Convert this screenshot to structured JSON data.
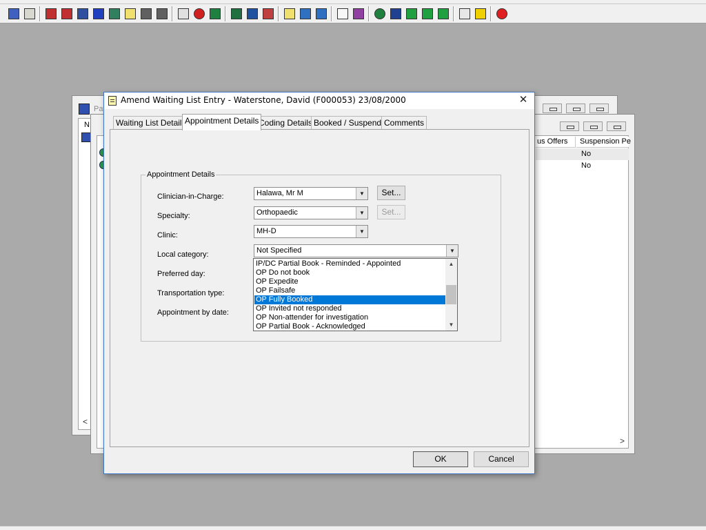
{
  "colors": {
    "desktop": "#aaaaaa",
    "selection": "#0078d7",
    "dialog_border": "#3e76c6"
  },
  "toolbar": {
    "icons": [
      {
        "name": "patient-icon",
        "color": "#4060c0"
      },
      {
        "name": "print-icon",
        "color": "#d8d8d0"
      },
      {
        "name": "book-icon",
        "color": "#c03030"
      },
      {
        "name": "notes-icon",
        "color": "#c03030"
      },
      {
        "name": "form-icon",
        "color": "#3050a0"
      },
      {
        "name": "mail-icon",
        "color": "#2040c0"
      },
      {
        "name": "doctor-icon",
        "color": "#308060"
      },
      {
        "name": "edit-icon",
        "color": "#f0e070"
      },
      {
        "name": "truck-icon",
        "color": "#606060"
      },
      {
        "name": "ambulance-icon",
        "color": "#606060"
      },
      {
        "name": "search-icon",
        "color": "#e0e0e0"
      },
      {
        "name": "clock-icon",
        "color": "#d02020"
      },
      {
        "name": "monitor-icon",
        "color": "#208040"
      },
      {
        "name": "screen-icon",
        "color": "#207040"
      },
      {
        "name": "screen-edit-icon",
        "color": "#2050a0"
      },
      {
        "name": "screen-clock-icon",
        "color": "#c04040"
      },
      {
        "name": "notepad-icon",
        "color": "#f0e070"
      },
      {
        "name": "bed-icon",
        "color": "#3070c0"
      },
      {
        "name": "bed-transfer-icon",
        "color": "#3070c0"
      },
      {
        "name": "document-icon",
        "color": "#f8f8f8"
      },
      {
        "name": "report-chart-icon",
        "color": "#9040a0"
      },
      {
        "name": "globe-icon",
        "color": "#208040"
      },
      {
        "name": "list-check-icon",
        "color": "#204090"
      },
      {
        "name": "list-down-icon",
        "color": "#20a040"
      },
      {
        "name": "list-arrow-icon",
        "color": "#20a040"
      },
      {
        "name": "list-swap-icon",
        "color": "#20a040"
      },
      {
        "name": "transfer-icon",
        "color": "#e8e8e8"
      },
      {
        "name": "warning-icon",
        "color": "#f0d000"
      },
      {
        "name": "exit-icon",
        "color": "#e02020"
      }
    ]
  },
  "background_windows": {
    "back_title_fragment": "Pat",
    "back_column_fragment": "N",
    "middle_column_headers": [
      "us Offers",
      "Suspension Pe"
    ],
    "middle_rows": [
      {
        "suspension": "No"
      },
      {
        "suspension": "No"
      }
    ],
    "scroll_left_glyph": "<",
    "scroll_right_glyph": ">"
  },
  "dialog": {
    "title": "Amend Waiting List Entry - Waterstone, David (F000053) 23/08/2000",
    "close_glyph": "✕",
    "tabs": [
      {
        "label": "Waiting List Details",
        "active": false
      },
      {
        "label": "Appointment Details",
        "active": true
      },
      {
        "label": "Coding Details",
        "active": false
      },
      {
        "label": "Booked / Suspend",
        "active": false
      },
      {
        "label": "Comments",
        "active": false
      }
    ],
    "group_title": "Appointment Details",
    "fields": {
      "clinician": {
        "label": "Clinician-in-Charge:",
        "value": "Halawa, Mr M",
        "button": "Set..."
      },
      "specialty": {
        "label": "Specialty:",
        "value": "Orthopaedic",
        "button": "Set..."
      },
      "clinic": {
        "label": "Clinic:",
        "value": "MH-D"
      },
      "local_category": {
        "label": "Local category:",
        "value": "Not Specified"
      },
      "preferred_day": {
        "label": "Preferred day:"
      },
      "transportation_type": {
        "label": "Transportation type:"
      },
      "appointment_by_date": {
        "label": "Appointment by date:"
      }
    },
    "dropdown_options": [
      "IP/DC Partial Book - Reminded - Appointed",
      "OP Do not book",
      "OP Expedite",
      "OP Failsafe",
      "OP Fully Booked",
      "OP Invited not responded",
      "OP Non-attender for investigation",
      "OP Partial Book - Acknowledged"
    ],
    "dropdown_selected": "OP Fully Booked",
    "ok_label": "OK",
    "cancel_label": "Cancel"
  }
}
